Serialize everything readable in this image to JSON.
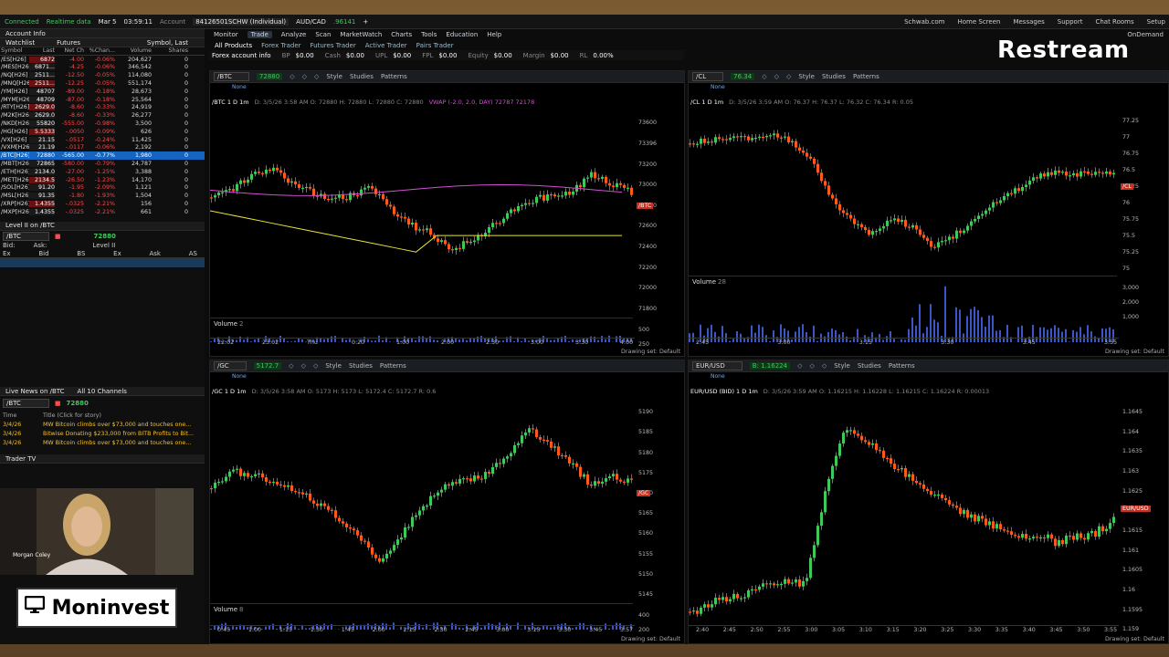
{
  "status": {
    "connected": "Connected",
    "realtime": "Realtime data",
    "date": "Mar 5",
    "time": "03:59:11",
    "account_label": "Account",
    "account": "84126501SCHW (Individual)",
    "pair": "AUD/CAD",
    "pair_price": ".96141"
  },
  "top_links": [
    "Schwab.com",
    "Home Screen",
    "Messages",
    "Support",
    "Chat Rooms",
    "Setup"
  ],
  "ondemand": "OnDemand",
  "menu": [
    "Monitor",
    "Trade",
    "Analyze",
    "Scan",
    "MarketWatch",
    "Charts",
    "Tools",
    "Education",
    "Help"
  ],
  "submenu": [
    "All Products",
    "Forex Trader",
    "Futures Trader",
    "Active Trader",
    "Pairs Trader"
  ],
  "acct_bar": {
    "label": "Forex account info",
    "items": [
      [
        "BP",
        "$0.00"
      ],
      [
        "Cash",
        "$0.00"
      ],
      [
        "UPL",
        "$0.00"
      ],
      [
        "FPL",
        "$0.00"
      ],
      [
        "Equity",
        "$0.00"
      ],
      [
        "Margin",
        "$0.00"
      ],
      [
        "RL",
        "0.00%"
      ]
    ]
  },
  "left": {
    "account_info": "Account Info",
    "watchlist_label": "Watchlist",
    "watchlist_name": "Futures",
    "symbol_last": "Symbol, Last",
    "columns": [
      "Symbol",
      "Last",
      "Net Ch",
      "%Chan...",
      "Volume",
      "Shares"
    ],
    "rows": [
      [
        "/ES[H26]",
        "6872",
        "-4.00",
        "-0.06%",
        "204,627",
        "0"
      ],
      [
        "/MES[H26]",
        "6871...",
        "-4.25",
        "-0.06%",
        "346,542",
        "0"
      ],
      [
        "/NQ[H26]",
        "2511...",
        "-12.50",
        "-0.05%",
        "114,080",
        "0"
      ],
      [
        "/MNQ[H26]",
        "2511...",
        "-12.25",
        "-0.05%",
        "551,174",
        "0"
      ],
      [
        "/YM[H26]",
        "48707",
        "-89.00",
        "-0.18%",
        "28,673",
        "0"
      ],
      [
        "/MYM[H26]",
        "48709",
        "-87.00",
        "-0.18%",
        "25,564",
        "0"
      ],
      [
        "/RTY[H26]",
        "2629.0",
        "-8.60",
        "-0.33%",
        "24,919",
        "0"
      ],
      [
        "/M2K[H26]",
        "2629.0",
        "-8.60",
        "-0.33%",
        "26,277",
        "0"
      ],
      [
        "/NKD[H26]",
        "55820",
        "-555.00",
        "-0.98%",
        "3,500",
        "0"
      ],
      [
        "/HG[H26]",
        "5.5333",
        "-.0050",
        "-0.09%",
        "626",
        "0"
      ],
      [
        "/VX[H26]",
        "21.15",
        "-.0517",
        "-0.24%",
        "11,425",
        "0"
      ],
      [
        "/VXM[H26]",
        "21.19",
        "-.0117",
        "-0.06%",
        "2,192",
        "0"
      ],
      [
        "/BTC[H26]",
        "72880",
        "-565.00",
        "-0.77%",
        "1,980",
        "0"
      ],
      [
        "/MBT[H26]",
        "72865",
        "-580.00",
        "-0.79%",
        "24,787",
        "0"
      ],
      [
        "/ETH[H26]",
        "2134.0",
        "-27.00",
        "-1.25%",
        "3,388",
        "0"
      ],
      [
        "/MET[H26]",
        "2134.5",
        "-26.50",
        "-1.23%",
        "14,170",
        "0"
      ],
      [
        "/SOL[H26]",
        "91.20",
        "-1.95",
        "-2.09%",
        "1,121",
        "0"
      ],
      [
        "/MSL[H26]",
        "91.35",
        "-1.80",
        "-1.93%",
        "1,504",
        "0"
      ],
      [
        "/XRP[H26]",
        "1.4355",
        "-.0325",
        "-2.21%",
        "156",
        "0"
      ],
      [
        "/MXP[H26]",
        "1.4355",
        "-.0325",
        "-2.21%",
        "661",
        "0"
      ]
    ],
    "level2_title": "Level II on /BTC",
    "level2_sym": "/BTC",
    "level2_price": "72880",
    "level2_bid": "Bid:",
    "level2_ask": "Ask:",
    "level2_label": "Level II",
    "level2_cols": [
      "Ex",
      "Bid",
      "BS",
      "Ex",
      "Ask",
      "AS"
    ],
    "news_title": "Live News on /BTC",
    "news_channels": "All 10 Channels",
    "news_sym": "/BTC",
    "news_price": "72880",
    "news_cols": [
      "Time",
      "Title (Click for story)"
    ],
    "news": [
      [
        "3/4/26",
        "MW Bitcoin climbs over $73,000 and touches one..."
      ],
      [
        "3/4/26",
        "Bitwise Donating $233,000 from BITB Profits to Bit..."
      ],
      [
        "3/4/26",
        "MW Bitcoin climbs over $73,000 and touches one..."
      ]
    ],
    "tradertv": "Trader TV",
    "host_name": "Morgan Coley",
    "host_caption": "Moninvest"
  },
  "logo": "Restream",
  "tool_words": {
    "style": "Style",
    "studies": "Studies",
    "patterns": "Patterns",
    "drawing": "Drawing set: Default",
    "none": "None",
    "volume": "Volume"
  },
  "charts": [
    {
      "sym": "/BTC",
      "price": "72880",
      "title": "/BTC 1 D 1m",
      "info": "D: 3/5/26 3:58 AM  O: 72880  H: 72880  L: 72880  C: 72880",
      "extra": "VWAP (-2.0, 2.0, DAY)  72787  72178",
      "yticks": [
        "73600",
        "73396",
        "73200",
        "73000",
        "72800",
        "72600",
        "72400",
        "72200",
        "72000",
        "71800"
      ],
      "xticks": [
        "22:02",
        "23:02",
        "Thu",
        "0:20",
        "1:00",
        "2:00",
        "2:30",
        "3:00",
        "3:30",
        "4:00"
      ],
      "vol_label": "2",
      "vol_ticks": [
        "500",
        "250"
      ]
    },
    {
      "sym": "/CL",
      "price": "76.34",
      "title": "/CL 1 D 1m",
      "info": "D: 3/5/26 3:59 AM  O: 76.37  H: 76.37  L: 76.32  C: 76.34  R: 0.05",
      "yticks": [
        "77.25",
        "77",
        "76.75",
        "76.5",
        "76.25",
        "76",
        "75.75",
        "75.5",
        "75.25",
        "75"
      ],
      "xticks": [
        "2:45",
        "3:00",
        "3:15",
        "3:30",
        "3:45",
        "3:55"
      ],
      "vol_label": "28",
      "vol_ticks": [
        "3,000",
        "2,000",
        "1,000"
      ]
    },
    {
      "sym": "/GC",
      "price": "5172.7",
      "title": "/GC 1 D 1m",
      "info": "D: 3/5/26 3:58 AM  O: 5173  H: 5173  L: 5172.4  C: 5172.7  R: 0.6",
      "yticks": [
        "5190",
        "5185",
        "5180",
        "5175",
        "5170",
        "5165",
        "5160",
        "5155",
        "5150",
        "5145"
      ],
      "xticks": [
        "0:45",
        "1:00",
        "1:15",
        "1:30",
        "1:45",
        "2:00",
        "2:15",
        "2:30",
        "2:45",
        "3:00",
        "3:15",
        "3:30",
        "3:45",
        "3:57"
      ],
      "vol_label": "8",
      "vol_ticks": [
        "400",
        "200"
      ]
    },
    {
      "sym": "EUR/USD",
      "price": "B: 1.16224",
      "title": "EUR/USD (BID) 1 D 1m",
      "info": "D: 3/5/26 3:59 AM  O: 1.16215  H: 1.16228  L: 1.16215  C: 1.16224  R: 0.00013",
      "yticks": [
        "1.1645",
        "1.164",
        "1.1635",
        "1.163",
        "1.1625",
        "1.162",
        "1.1615",
        "1.161",
        "1.1605",
        "1.16",
        "1.1595",
        "1.159"
      ],
      "xticks": [
        "2:40",
        "2:45",
        "2:50",
        "2:55",
        "3:00",
        "3:05",
        "3:10",
        "3:15",
        "3:20",
        "3:25",
        "3:30",
        "3:35",
        "3:40",
        "3:45",
        "3:50",
        "3:55"
      ]
    }
  ],
  "colors": {
    "up": "#3ec95b",
    "down": "#ff5a1a",
    "vwap": "#d34fd3",
    "sma": "#e8e23a",
    "volume": "#3a56c8"
  }
}
